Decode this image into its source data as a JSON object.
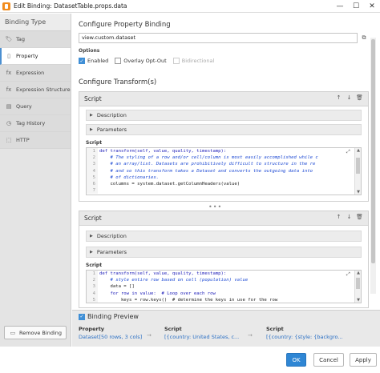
{
  "window": {
    "title": "Edit Binding: DatasetTable.props.data",
    "minimize": "—",
    "maximize": "☐",
    "close": "✕"
  },
  "sidebar": {
    "heading": "Binding Type",
    "items": [
      {
        "label": "Tag",
        "icon": "🏷"
      },
      {
        "label": "Property",
        "icon": "▯"
      },
      {
        "label": "Expression",
        "icon": "fx"
      },
      {
        "label": "Expression Structure",
        "icon": "fx"
      },
      {
        "label": "Query",
        "icon": "▤"
      },
      {
        "label": "Tag History",
        "icon": "◷"
      },
      {
        "label": "HTTP",
        "icon": "⬚"
      }
    ],
    "remove_button": "Remove Binding",
    "remove_icon": "▭"
  },
  "property": {
    "section_title": "Configure Property Binding",
    "path_value": "view.custom.dataset",
    "path_button": "⧉",
    "options_label": "Options",
    "options": [
      {
        "label": "Enabled",
        "checked": true,
        "disabled": false
      },
      {
        "label": "Overlay Opt-Out",
        "checked": false,
        "disabled": false
      },
      {
        "label": "Bidirectional",
        "checked": false,
        "disabled": true
      }
    ]
  },
  "transforms": {
    "section_title": "Configure Transform(s)",
    "items": [
      {
        "title": "Script",
        "description_label": "Description",
        "parameters_label": "Parameters",
        "script_label": "Script",
        "lines": [
          {
            "n": "1",
            "text": "def transform(self, value, quality, timestamp):",
            "kind": "kw"
          },
          {
            "n": "2",
            "text": "    # The styling of a row and/or cell/column is most easily accomplished while c",
            "kind": "cm"
          },
          {
            "n": "3",
            "text": "    # an array/list. Datasets are prohibitively difficult to structure in the re",
            "kind": "cm"
          },
          {
            "n": "4",
            "text": "    # and so this transform takes a Dataset and converts the outgoing data into",
            "kind": "cm"
          },
          {
            "n": "5",
            "text": "    # of dictionaries.",
            "kind": "cm"
          },
          {
            "n": "6",
            "text": "    columns = system.dataset.getColumnHeaders(value)",
            "kind": "plain"
          },
          {
            "n": "7",
            "text": "",
            "kind": "plain"
          }
        ]
      },
      {
        "title": "Script",
        "description_label": "Description",
        "parameters_label": "Parameters",
        "script_label": "Script",
        "lines": [
          {
            "n": "1",
            "text": "def transform(self, value, quality, timestamp):",
            "kind": "kw"
          },
          {
            "n": "2",
            "text": "    # style entire row based on cell (population) value",
            "kind": "cm"
          },
          {
            "n": "3",
            "text": "    data = []",
            "kind": "plain"
          },
          {
            "n": "4",
            "text": "    for row in value:  # Loop over each row",
            "kind": "kw"
          },
          {
            "n": "5",
            "text": "        keys = row.keys()  # determine the keys in use for the row",
            "kind": "plain"
          }
        ]
      }
    ],
    "controls": {
      "up": "↑",
      "down": "↓",
      "delete": "🗑"
    }
  },
  "preview": {
    "title": "Binding Preview",
    "enabled": true,
    "columns": [
      {
        "label": "Property",
        "value": "Dataset[50 rows, 3 cols]"
      },
      {
        "label": "Script",
        "value": "[{country: United States, c..."
      },
      {
        "label": "Script",
        "value": "[{country: {style: {backgro..."
      }
    ]
  },
  "footer": {
    "ok": "OK",
    "cancel": "Cancel",
    "apply": "Apply"
  },
  "colors": {
    "accent": "#2f86d4",
    "link": "#2a6fc4",
    "app_icon": "#f28c1e"
  }
}
